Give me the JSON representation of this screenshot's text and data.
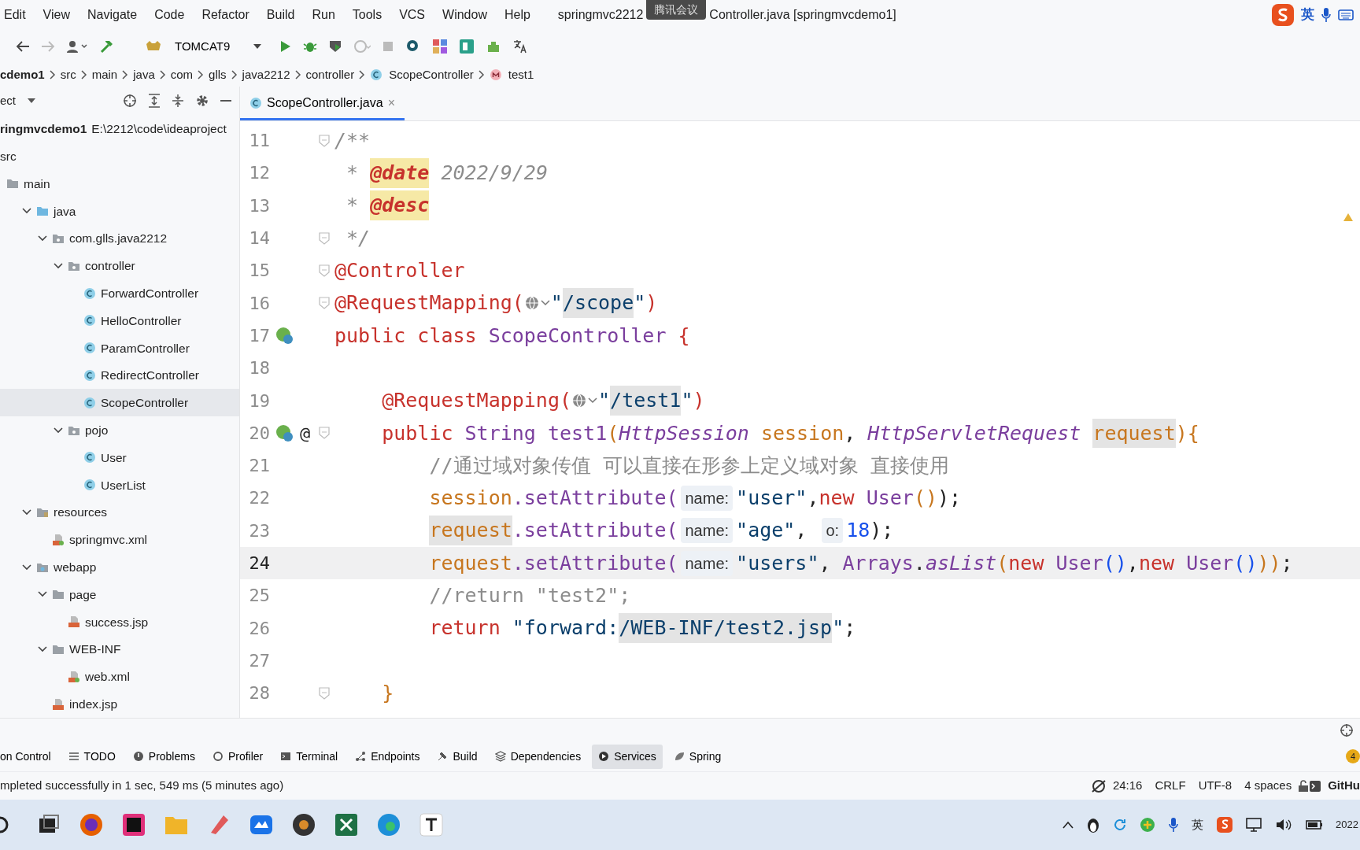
{
  "menu": [
    "Edit",
    "View",
    "Navigate",
    "Code",
    "Refactor",
    "Build",
    "Run",
    "Tools",
    "VCS",
    "Window",
    "Help"
  ],
  "title": {
    "start": "springmvc2212",
    "overlay": "腾讯会议",
    "rest": "Controller.java [springmvcdemo1]"
  },
  "ime": {
    "label": "英"
  },
  "toolbar": {
    "run_config": "TOMCAT9"
  },
  "breadcrumbs": [
    {
      "text": "cdemo1",
      "kind": "bold"
    },
    {
      "text": "src",
      "kind": "plain"
    },
    {
      "text": "main",
      "kind": "plain"
    },
    {
      "text": "java",
      "kind": "plain"
    },
    {
      "text": "com",
      "kind": "plain"
    },
    {
      "text": "glls",
      "kind": "plain"
    },
    {
      "text": "java2212",
      "kind": "plain"
    },
    {
      "text": "controller",
      "kind": "plain"
    },
    {
      "text": "ScopeController",
      "kind": "class"
    },
    {
      "text": "test1",
      "kind": "method"
    }
  ],
  "project_panel": {
    "title": "ect",
    "root": {
      "name": "ringmvcdemo1",
      "path": "E:\\2212\\code\\ideaproject"
    },
    "tree": [
      {
        "name": "src",
        "selected": false,
        "children": [
          {
            "name": "main",
            "kind": "folder",
            "selected": false,
            "children": [
              {
                "name": "java",
                "kind": "source",
                "expanded": true,
                "selected": false,
                "children": [
                  {
                    "name": "com.glls.java2212",
                    "kind": "package",
                    "expanded": true,
                    "selected": false,
                    "children": [
                      {
                        "name": "controller",
                        "kind": "package",
                        "expanded": true,
                        "selected": false,
                        "children": [
                          {
                            "name": "ForwardController",
                            "kind": "class",
                            "selected": false
                          },
                          {
                            "name": "HelloController",
                            "kind": "class",
                            "selected": false
                          },
                          {
                            "name": "ParamController",
                            "kind": "class",
                            "selected": false
                          },
                          {
                            "name": "RedirectController",
                            "kind": "class",
                            "selected": false
                          },
                          {
                            "name": "ScopeController",
                            "kind": "class",
                            "selected": true
                          }
                        ]
                      },
                      {
                        "name": "pojo",
                        "kind": "package",
                        "expanded": true,
                        "selected": false,
                        "children": [
                          {
                            "name": "User",
                            "kind": "class",
                            "selected": false
                          },
                          {
                            "name": "UserList",
                            "kind": "class",
                            "selected": false
                          }
                        ]
                      }
                    ]
                  }
                ]
              },
              {
                "name": "resources",
                "kind": "resources",
                "expanded": true,
                "selected": false,
                "children": [
                  {
                    "name": "springmvc.xml",
                    "kind": "xml",
                    "selected": false
                  }
                ]
              },
              {
                "name": "webapp",
                "kind": "web",
                "expanded": true,
                "selected": false,
                "children": [
                  {
                    "name": "page",
                    "kind": "folder",
                    "expanded": true,
                    "selected": false,
                    "children": [
                      {
                        "name": "success.jsp",
                        "kind": "jsp",
                        "selected": false
                      }
                    ]
                  },
                  {
                    "name": "WEB-INF",
                    "kind": "folder",
                    "expanded": true,
                    "selected": false,
                    "children": [
                      {
                        "name": "web.xml",
                        "kind": "xml",
                        "selected": false
                      }
                    ]
                  },
                  {
                    "name": "index.jsp",
                    "kind": "jsp",
                    "selected": false
                  }
                ]
              }
            ]
          }
        ]
      }
    ]
  },
  "editor_tab": {
    "label": "ScopeController.java",
    "close": "×"
  },
  "code": [
    {
      "number": "11",
      "kind": "top",
      "fold": true,
      "bean": false,
      "tokens": [
        {
          "text": "/**",
          "kind": "comment"
        }
      ]
    },
    {
      "number": "12",
      "kind": "top",
      "fold": false,
      "bean": false,
      "tokens": [
        {
          "text": " * ",
          "kind": "comment"
        },
        {
          "text": "@date",
          "kind": "doctag"
        },
        {
          "text": " 2022/9/29",
          "kind": "comment"
        }
      ]
    },
    {
      "number": "13",
      "kind": "top",
      "fold": false,
      "bean": false,
      "tokens": [
        {
          "text": " * ",
          "kind": "comment"
        },
        {
          "text": "@desc",
          "kind": "doctag"
        }
      ]
    },
    {
      "number": "14",
      "kind": "top",
      "fold": true,
      "bean": false,
      "tokens": [
        {
          "text": " */",
          "kind": "comment"
        }
      ]
    },
    {
      "number": "15",
      "kind": "top",
      "fold": true,
      "bean": false,
      "tokens": [
        {
          "text": "@Controller",
          "kind": "keyword"
        }
      ]
    },
    {
      "number": "16",
      "kind": "top",
      "fold": true,
      "bean": false,
      "tokens": [
        {
          "text": "@RequestMapping(",
          "kind": "keyword"
        },
        {
          "kind": "globe"
        },
        {
          "text": "\"",
          "kind": "string"
        },
        {
          "text": "/scope",
          "kind": "string-hl"
        },
        {
          "text": "\"",
          "kind": "string"
        },
        {
          "text": ")",
          "kind": "keyword"
        }
      ]
    },
    {
      "number": "17",
      "kind": "top",
      "fold": false,
      "bean": true,
      "tokens": [
        {
          "text": "public class ",
          "kind": "keyword"
        },
        {
          "text": "ScopeController",
          "kind": "class"
        },
        {
          "text": " {",
          "kind": "keyword"
        }
      ]
    },
    {
      "number": "18",
      "kind": "top",
      "fold": false,
      "bean": false
    },
    {
      "number": "19",
      "kind": "member",
      "fold": false,
      "bean": false,
      "tokens": [
        {
          "text": "@RequestMapping(",
          "kind": "keyword"
        },
        {
          "kind": "globe"
        },
        {
          "text": "\"",
          "kind": "string"
        },
        {
          "text": "/test1",
          "kind": "string-hl"
        },
        {
          "text": "\"",
          "kind": "string"
        },
        {
          "text": ")",
          "kind": "keyword"
        }
      ]
    },
    {
      "number": "20",
      "kind": "member",
      "fold": true,
      "bean": true,
      "at": "@",
      "tokens": [
        {
          "text": "public ",
          "kind": "keyword"
        },
        {
          "text": "String ",
          "kind": "class"
        },
        {
          "text": "test1",
          "kind": "method"
        },
        {
          "text": "(",
          "kind": "field"
        },
        {
          "text": "HttpSession",
          "kind": "type"
        },
        {
          "text": " session",
          "kind": "field"
        },
        {
          "text": ", ",
          "kind": "plain"
        },
        {
          "text": "HttpServletRequest ",
          "kind": "type"
        },
        {
          "text": "request",
          "kind": "field-hl"
        },
        {
          "text": "){",
          "kind": "field"
        }
      ]
    },
    {
      "number": "21",
      "kind": "body",
      "fold": false,
      "bean": false,
      "tokens": [
        {
          "text": "//通过域对象传值 可以直接在形参上定义域对象 直接使用",
          "kind": "comment2"
        }
      ]
    },
    {
      "number": "22",
      "kind": "body",
      "fold": false,
      "bean": false,
      "tokens": [
        {
          "text": "session",
          "kind": "field"
        },
        {
          "text": ".setAttribute(",
          "kind": "method"
        },
        {
          "text": "name:",
          "kind": "hint"
        },
        {
          "text": "\"user\"",
          "kind": "string"
        },
        {
          "text": ",",
          "kind": "plain"
        },
        {
          "text": "new ",
          "kind": "keyword"
        },
        {
          "text": "User",
          "kind": "class"
        },
        {
          "text": "()",
          "kind": "field"
        },
        {
          "text": ");",
          "kind": "plain"
        }
      ]
    },
    {
      "number": "23",
      "kind": "body",
      "fold": false,
      "bean": false,
      "tokens": [
        {
          "text": "request",
          "kind": "field-hl"
        },
        {
          "text": ".setAttribute(",
          "kind": "method"
        },
        {
          "text": "name:",
          "kind": "hint"
        },
        {
          "text": "\"age\"",
          "kind": "string"
        },
        {
          "text": ", ",
          "kind": "plain"
        },
        {
          "text": "o:",
          "kind": "hint"
        },
        {
          "text": "18",
          "kind": "number"
        },
        {
          "text": ");",
          "kind": "plain"
        }
      ]
    },
    {
      "number": "24",
      "kind": "body",
      "fold": false,
      "bean": false,
      "current": true,
      "tokens": [
        {
          "text": "request",
          "kind": "field"
        },
        {
          "text": ".setAttribute(",
          "kind": "method"
        },
        {
          "text": "name:",
          "kind": "hint"
        },
        {
          "text": "\"users\"",
          "kind": "string"
        },
        {
          "text": ", ",
          "kind": "plain"
        },
        {
          "text": "Arrays",
          "kind": "class"
        },
        {
          "text": ".",
          "kind": "plain"
        },
        {
          "text": "asList",
          "kind": "type"
        },
        {
          "text": "(",
          "kind": "field"
        },
        {
          "text": "new ",
          "kind": "keyword"
        },
        {
          "text": "User",
          "kind": "class"
        },
        {
          "text": "()",
          "kind": "number"
        },
        {
          "text": ",",
          "kind": "plain"
        },
        {
          "text": "new ",
          "kind": "keyword"
        },
        {
          "text": "User",
          "kind": "class"
        },
        {
          "text": "()",
          "kind": "number"
        },
        {
          "text": "))",
          "kind": "field"
        },
        {
          "text": ";",
          "kind": "plain"
        }
      ]
    },
    {
      "number": "25",
      "kind": "body",
      "fold": false,
      "bean": false,
      "tokens": [
        {
          "text": "//return \"test2\";",
          "kind": "comment2"
        }
      ]
    },
    {
      "number": "26",
      "kind": "body",
      "fold": false,
      "bean": false,
      "tokens": [
        {
          "text": "return ",
          "kind": "keyword"
        },
        {
          "text": "\"forward:",
          "kind": "string"
        },
        {
          "text": "/WEB-INF/test2.jsp",
          "kind": "string-hl"
        },
        {
          "text": "\"",
          "kind": "string"
        },
        {
          "text": ";",
          "kind": "plain"
        }
      ]
    },
    {
      "number": "27",
      "kind": "top",
      "fold": false,
      "bean": false
    },
    {
      "number": "28",
      "kind": "member",
      "fold": true,
      "bean": false,
      "tokens": [
        {
          "text": "}",
          "kind": "field"
        }
      ]
    }
  ],
  "tool_tabs": [
    {
      "label": "on Control",
      "selected": false
    },
    {
      "label": "TODO",
      "selected": false
    },
    {
      "label": "Problems",
      "selected": false
    },
    {
      "label": "Profiler",
      "selected": false
    },
    {
      "label": "Terminal",
      "selected": false
    },
    {
      "label": "Endpoints",
      "selected": false
    },
    {
      "label": "Build",
      "selected": false
    },
    {
      "label": "Dependencies",
      "selected": false
    },
    {
      "label": "Services",
      "selected": true
    },
    {
      "label": "Spring",
      "selected": false
    }
  ],
  "event_badge": "4",
  "status_bar": {
    "message": "mpleted successfully in 1 sec, 549 ms (5 minutes ago)",
    "position": "24:16",
    "line_ending": "CRLF",
    "encoding": "UTF-8",
    "indent": "4 spaces",
    "vcs": "GitHu"
  },
  "taskbar": {
    "tray_ime": "英",
    "date": "2022"
  }
}
